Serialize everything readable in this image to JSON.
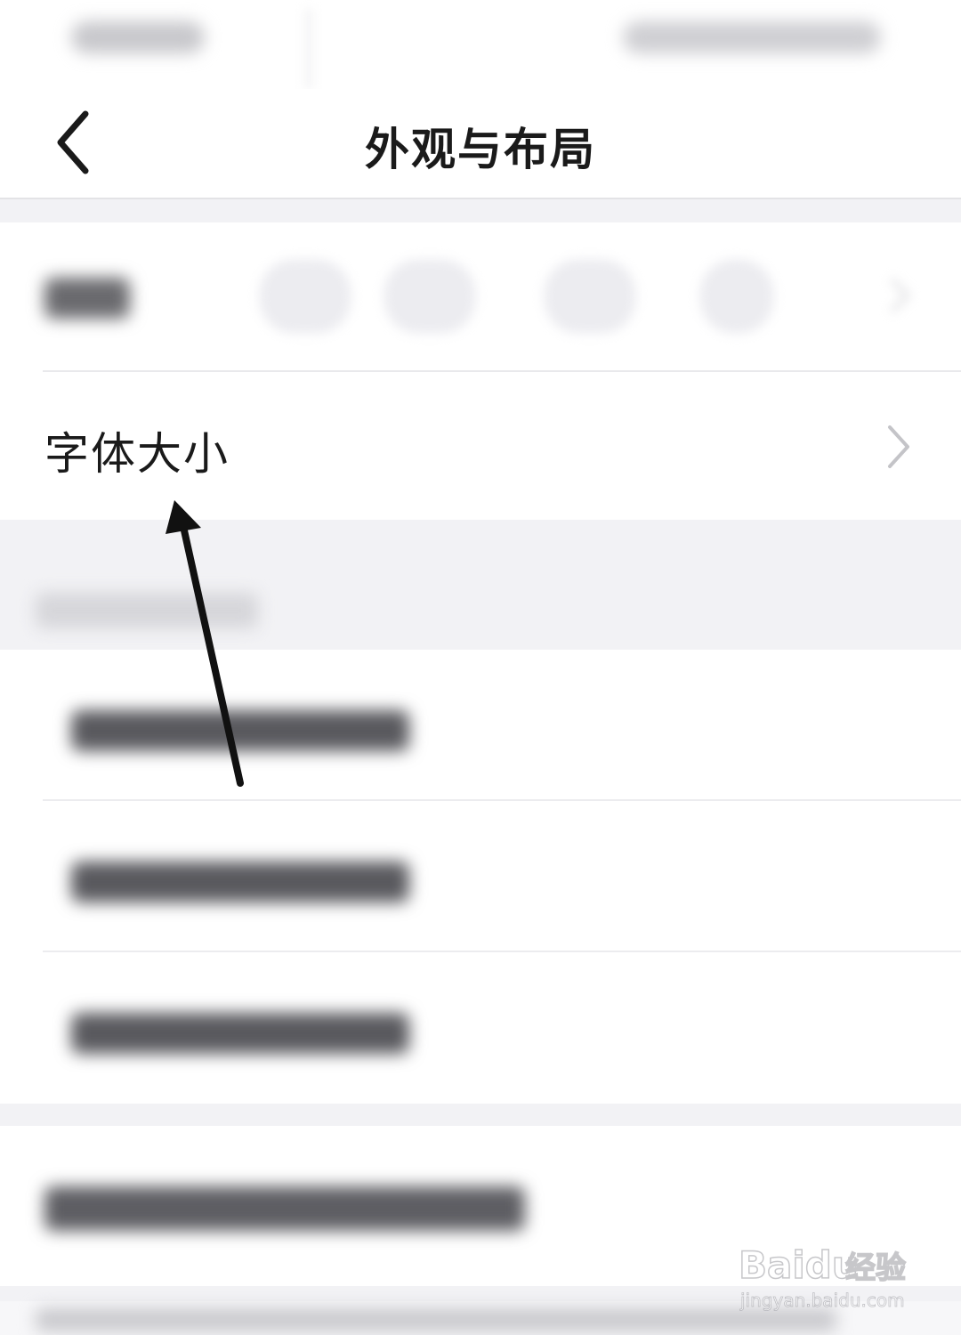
{
  "nav": {
    "title": "外观与布局",
    "back_icon": "chevron-left-icon"
  },
  "settings": {
    "font_size_label": "字体大小",
    "chevron_icon": "chevron-right-icon"
  },
  "watermark": {
    "brand": "Baidu",
    "product": "经验",
    "url": "jingyan.baidu.com"
  },
  "colors": {
    "background": "#f2f2f5",
    "surface": "#ffffff",
    "text": "#1a1a1a",
    "chevron": "#c4c4c8"
  }
}
